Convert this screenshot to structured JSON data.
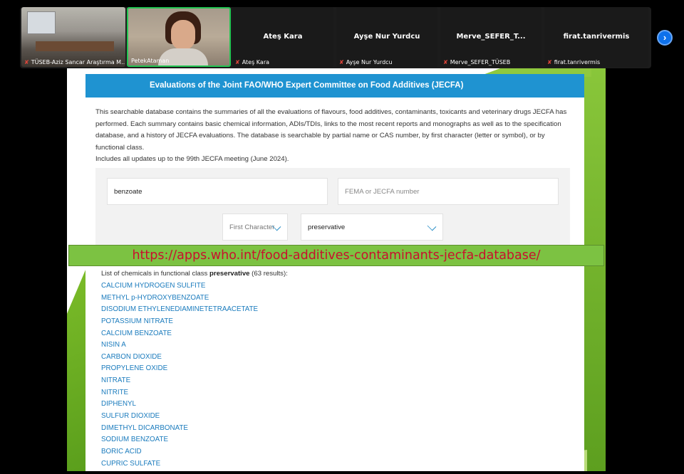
{
  "participants": [
    {
      "name": "TÜSEB-Aziz Sancar Araştırma M...",
      "muted": true,
      "video": "room"
    },
    {
      "name": "PetekAtaman",
      "muted": false,
      "video": "face",
      "active_speaker": true
    },
    {
      "display_name": "Ateş Kara",
      "name": "Ateş Kara",
      "muted": true
    },
    {
      "display_name": "Ayşe Nur Yurdcu",
      "name": "Ayşe Nur Yurdcu",
      "muted": true
    },
    {
      "display_name": "Merve_SEFER_T...",
      "name": "Merve_SEFER_TÜSEB",
      "muted": true
    },
    {
      "display_name": "firat.tanrivermis",
      "name": "firat.tanrivermis",
      "muted": true
    }
  ],
  "next_button": "›",
  "page": {
    "header": "Evaluations of the Joint FAO/WHO Expert Committee on Food Additives (JECFA)",
    "intro": "This searchable database contains the summaries of all the evaluations of flavours, food additives, contaminants, toxicants and veterinary drugs JECFA has performed. Each summary contains basic chemical information, ADIs/TDIs, links to the most recent reports and monographs as well as to the specification database, and a history of JECFA evaluations. The database is searchable by partial name or CAS number, by first character (letter or symbol), or by functional class.",
    "updates": "Includes all updates up to the 99th JECFA meeting (June 2024).",
    "search": {
      "name_value": "benzoate",
      "number_placeholder": "FEMA or JECFA number",
      "first_character": "First Character",
      "functional_class": "preservative"
    },
    "url_banner": "https://apps.who.int/food-additives-contaminants-jecfa-database/",
    "results_prefix": "List of chemicals in functional class ",
    "results_class": "preservative",
    "results_suffix": " (63 results):",
    "results": [
      "CALCIUM HYDROGEN SULFITE",
      "METHYL p-HYDROXYBENZOATE",
      "DISODIUM ETHYLENEDIAMINETETRAACETATE",
      "POTASSIUM NITRATE",
      "CALCIUM BENZOATE",
      "NISIN A",
      "CARBON DIOXIDE",
      "PROPYLENE OXIDE",
      "NITRATE",
      "NITRITE",
      "DIPHENYL",
      "SULFUR DIOXIDE",
      "DIMETHYL DICARBONATE",
      "SODIUM BENZOATE",
      "BORIC ACID",
      "CUPRIC SULFATE"
    ]
  },
  "colors": {
    "header_blue": "#1f93d1",
    "link_blue": "#1a7bbd",
    "banner_green": "#7cc242",
    "banner_text_red": "#c8102e",
    "speaker_border": "#23c552"
  }
}
